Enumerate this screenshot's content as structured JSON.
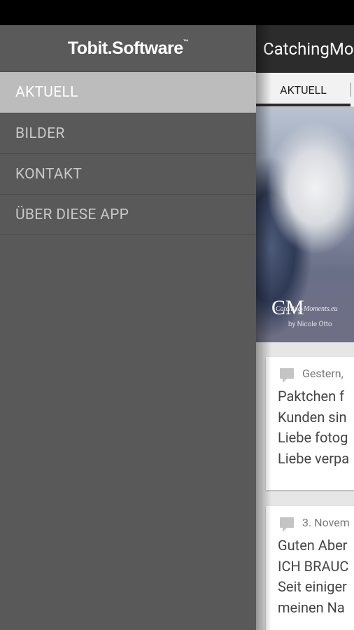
{
  "drawer": {
    "logo": "Tobit.Software",
    "logo_tm": "™",
    "items": [
      {
        "label": "AKTUELL",
        "active": true
      },
      {
        "label": "BILDER",
        "active": false
      },
      {
        "label": "KONTAKT",
        "active": false
      },
      {
        "label": "ÜBER DIESE APP",
        "active": false
      }
    ]
  },
  "main": {
    "app_title": "CatchingMo",
    "tabs": [
      {
        "label": "AKTUELL"
      }
    ],
    "hero": {
      "monogram": "CM",
      "script_text": "Catching-Moments.eu",
      "byline": "by Nicole Otto"
    },
    "posts": [
      {
        "date": "Gestern,",
        "lines": [
          "Paktchen f",
          "Kunden sin",
          "Liebe fotog",
          "Liebe verpa"
        ]
      },
      {
        "date": "3. Novem",
        "lines": [
          "Guten Aber",
          "ICH BRAUC",
          "Seit einiger",
          "meinen Na"
        ]
      }
    ]
  },
  "colors": {
    "drawer_bg": "#595959",
    "drawer_active": "#bcbcbc",
    "appbar_bg": "#2c2c2c",
    "content_bg": "#e6e6e6"
  }
}
